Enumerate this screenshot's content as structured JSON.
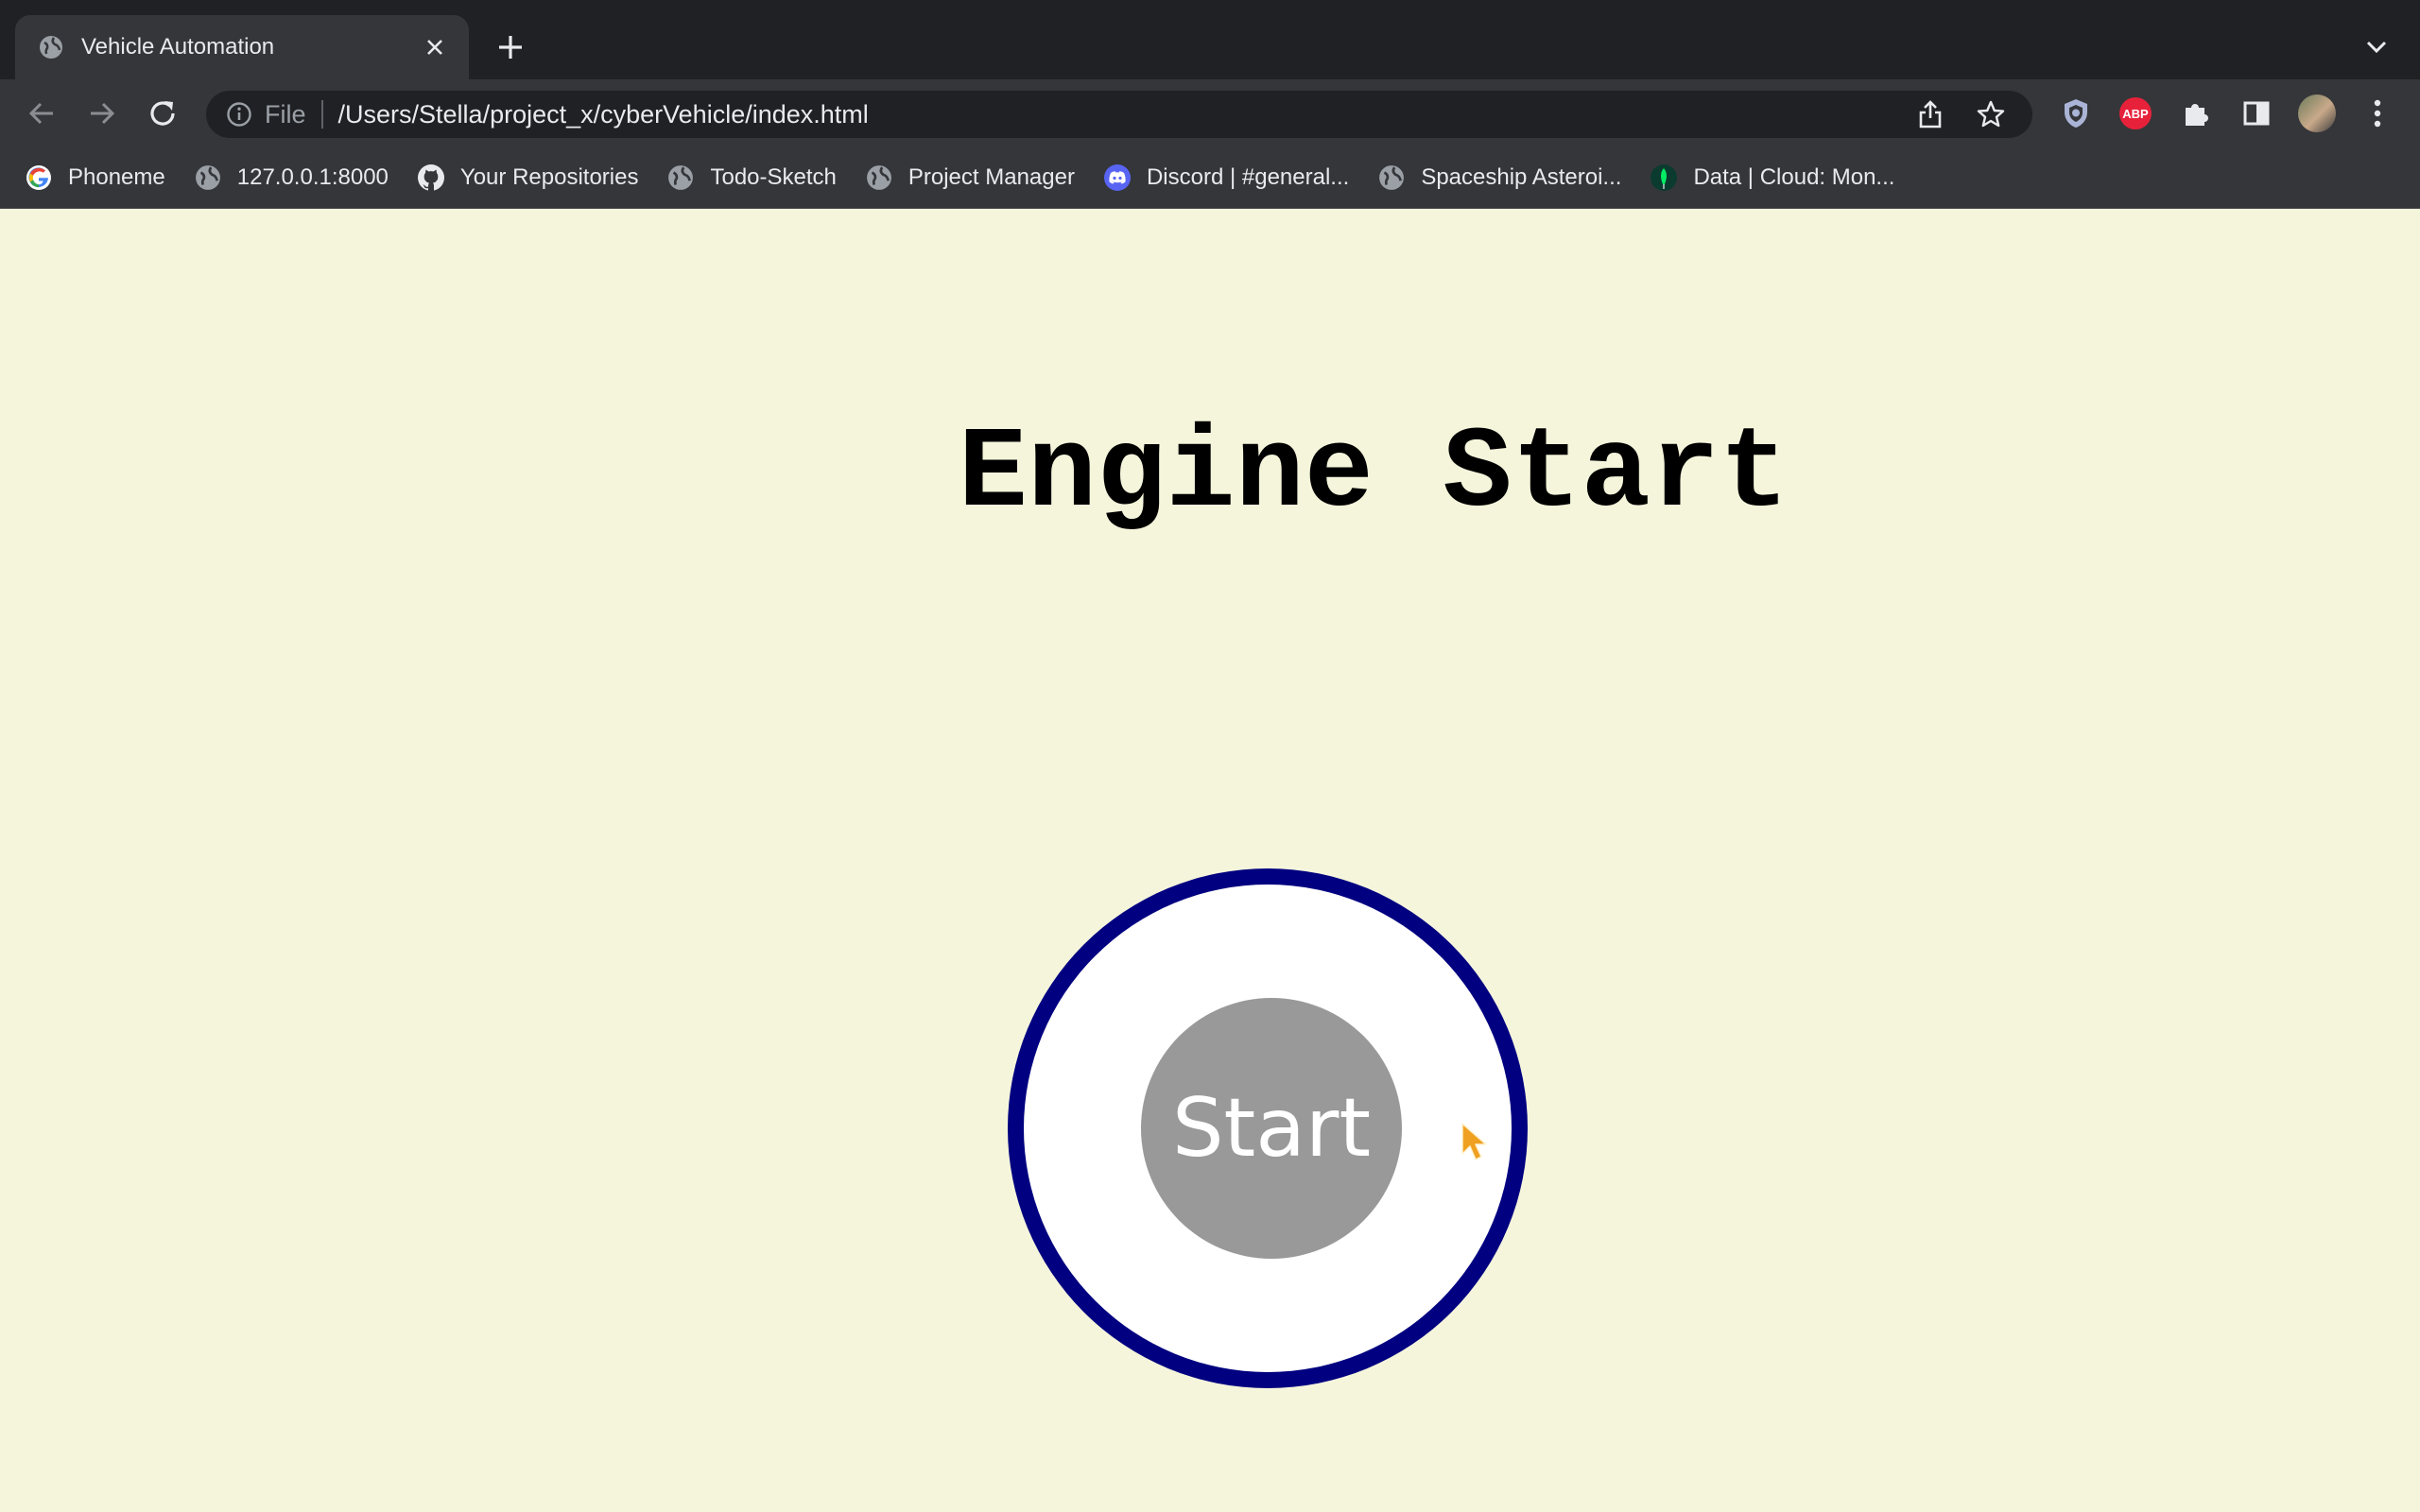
{
  "browser": {
    "tab": {
      "title": "Vehicle Automation",
      "favicon": "globe-icon"
    },
    "address_bar": {
      "scheme_label": "File",
      "url": "/Users/Stella/project_x/cyberVehicle/index.html"
    },
    "bookmarks": [
      {
        "label": "Phoneme",
        "icon": "google-icon"
      },
      {
        "label": "127.0.0.1:8000",
        "icon": "globe-icon"
      },
      {
        "label": "Your Repositories",
        "icon": "github-icon"
      },
      {
        "label": "Todo-Sketch",
        "icon": "globe-icon"
      },
      {
        "label": "Project Manager",
        "icon": "globe-icon"
      },
      {
        "label": "Discord | #general...",
        "icon": "discord-icon"
      },
      {
        "label": "Spaceship Asteroi...",
        "icon": "globe-icon"
      },
      {
        "label": "Data | Cloud: Mon...",
        "icon": "mongodb-leaf-icon"
      }
    ],
    "extensions": {
      "adblock_label": "ABP"
    }
  },
  "page": {
    "heading": "Engine Start",
    "start_button_label": "Start"
  },
  "colors": {
    "page_background": "#f5f5dc",
    "ring": "#000080",
    "button": "#999999",
    "cursor": "#f0a020"
  }
}
